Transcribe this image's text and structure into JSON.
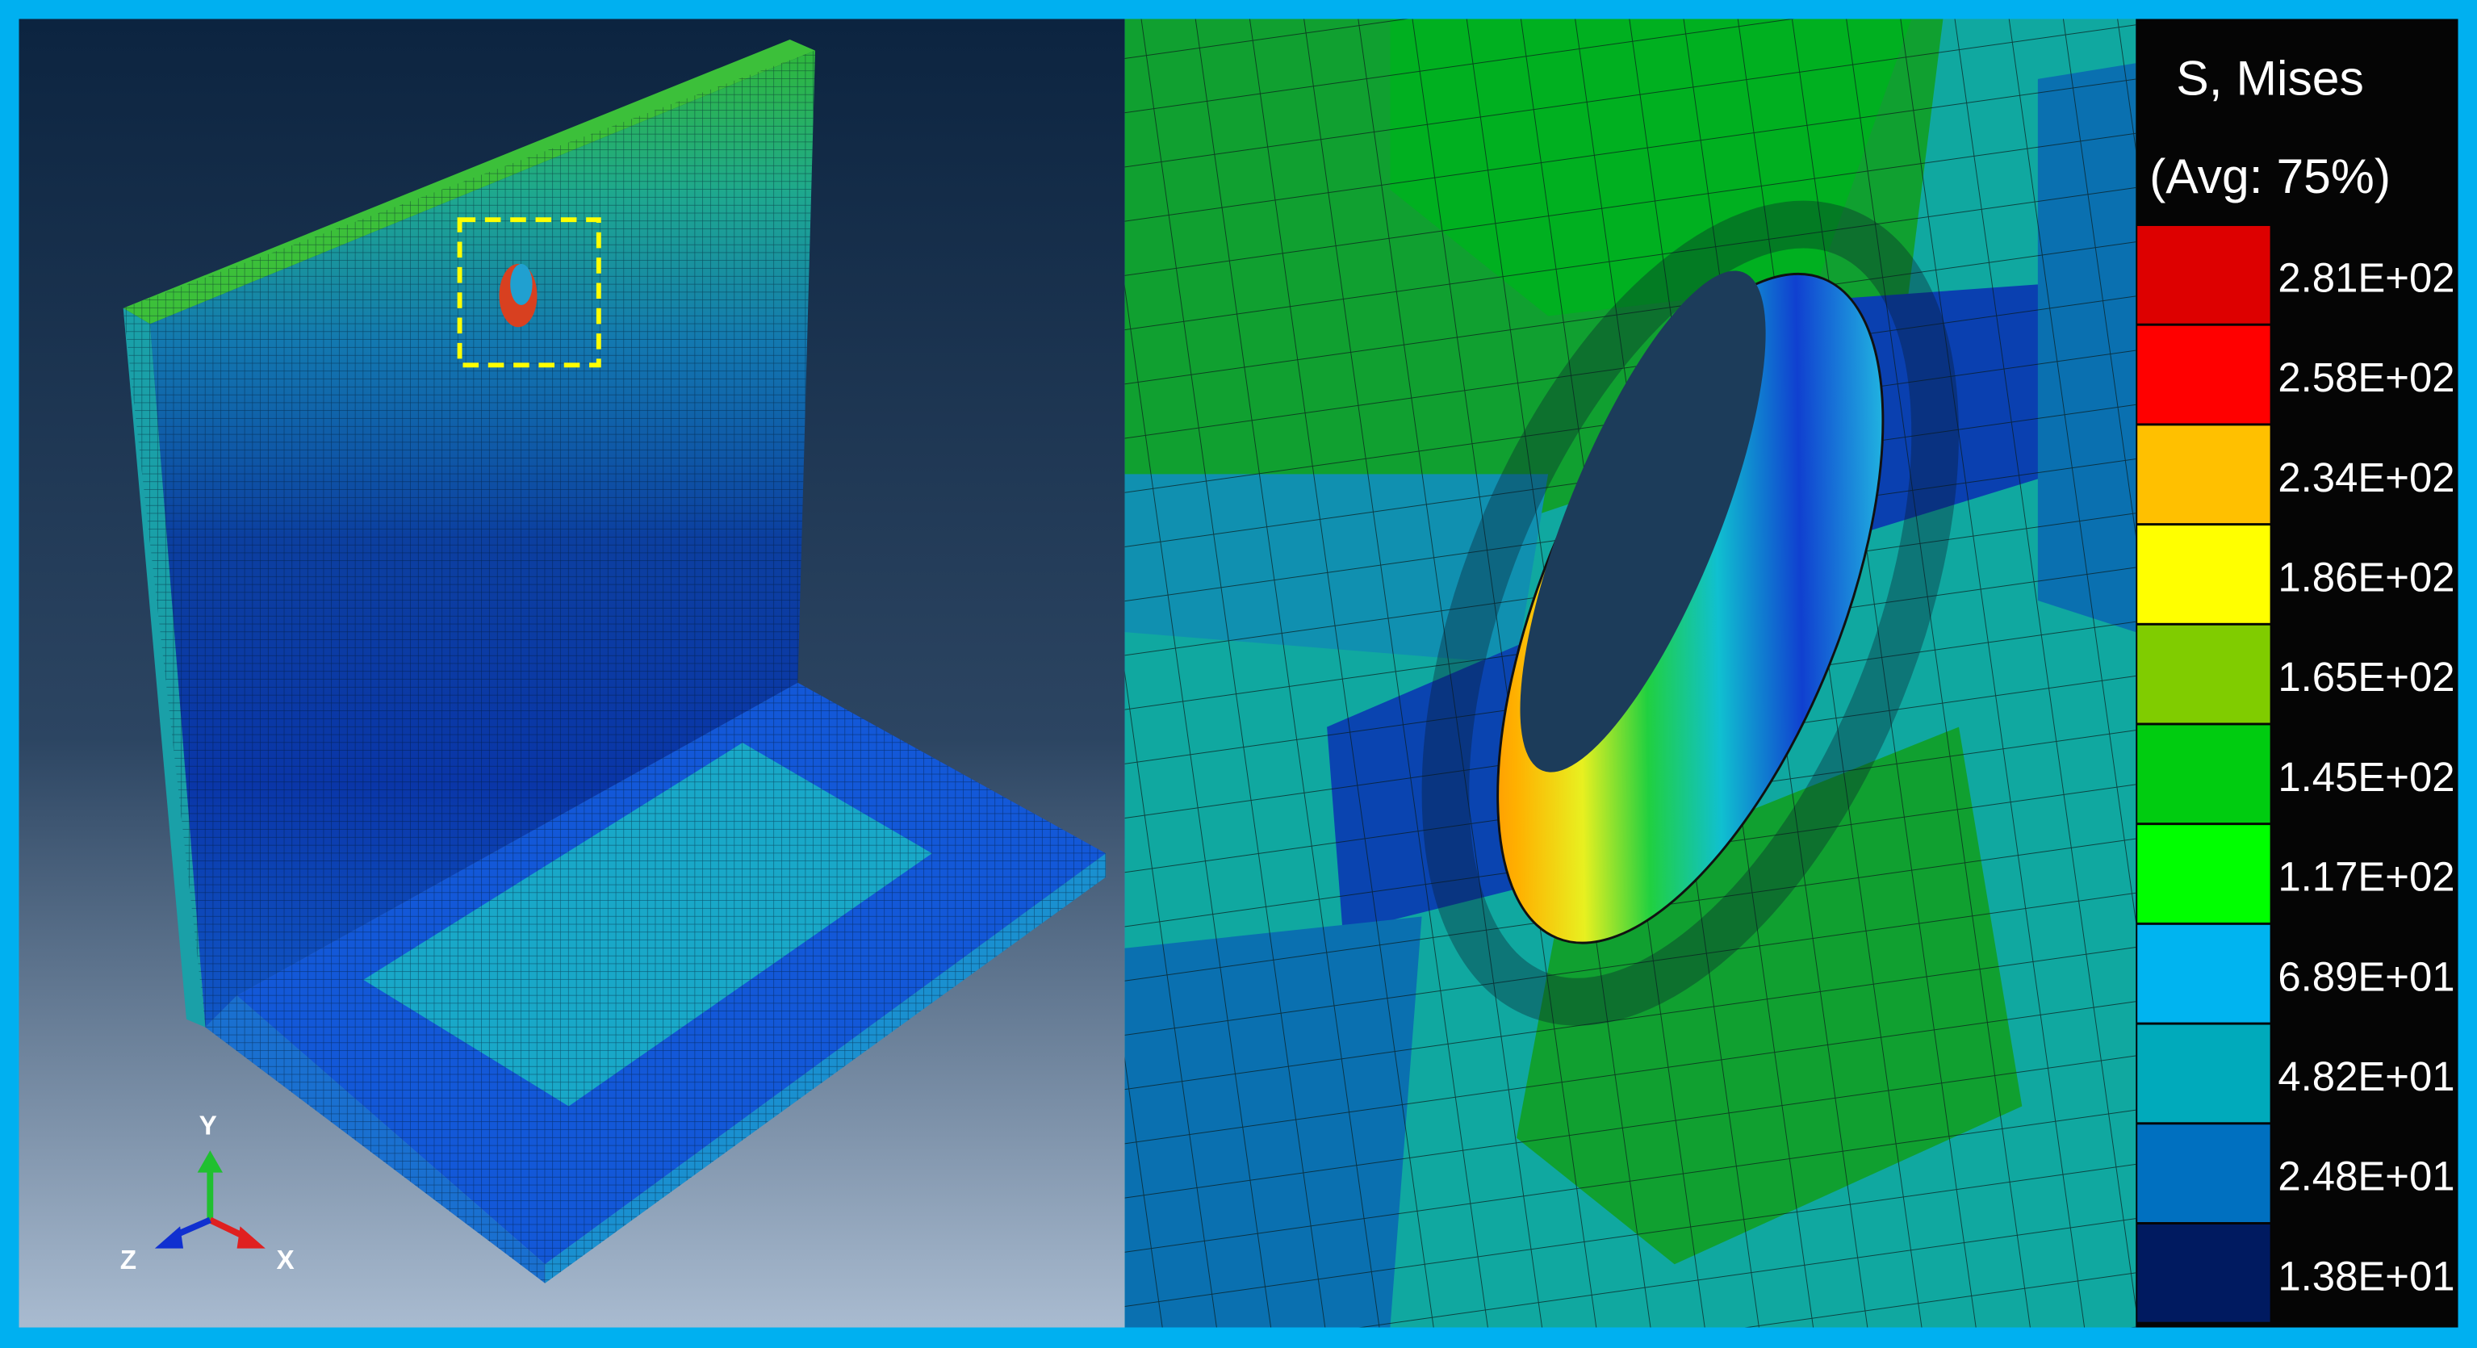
{
  "left_view": {
    "axis_labels": {
      "y": "Y",
      "z": "Z",
      "x": "X"
    },
    "highlight_box_color": "#ffff00"
  },
  "legend": {
    "title": "S, Mises",
    "subtitle": "(Avg: 75%)",
    "entries": [
      {
        "value": "2.81E+02",
        "color": "#dd0000"
      },
      {
        "value": "2.58E+02",
        "color": "#ff0000"
      },
      {
        "value": "2.34E+02",
        "color": "#ffc000"
      },
      {
        "value": "1.86E+02",
        "color": "#ffff00"
      },
      {
        "value": "1.65E+02",
        "color": "#80cc00"
      },
      {
        "value": "1.45E+02",
        "color": "#00cc10"
      },
      {
        "value": "1.17E+02",
        "color": "#00ff00"
      },
      {
        "value": "6.89E+01",
        "color": "#00b4f0"
      },
      {
        "value": "4.82E+01",
        "color": "#00aabb"
      },
      {
        "value": "2.48E+01",
        "color": "#0070c0"
      },
      {
        "value": "1.38E+01",
        "color": "#001a60"
      }
    ]
  },
  "colors": {
    "frame": "#00b0f0",
    "legend_bg": "#050505"
  }
}
